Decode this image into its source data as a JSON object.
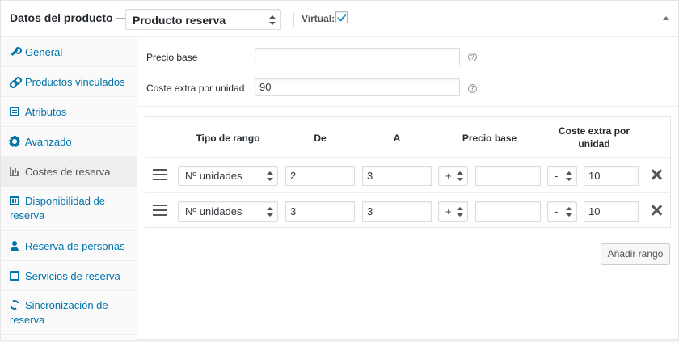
{
  "header": {
    "title": "Datos del producto —",
    "product_type": "Producto reserva",
    "virtual_label": "Virtual:",
    "virtual_checked": true
  },
  "sidebar": {
    "items": [
      {
        "label": "General",
        "icon": "wrench-icon",
        "active": false
      },
      {
        "label": "Productos vinculados",
        "icon": "link-icon",
        "active": false
      },
      {
        "label": "Atributos",
        "icon": "list-icon",
        "active": false
      },
      {
        "label": "Avanzado",
        "icon": "gear-icon",
        "active": false
      },
      {
        "label": "Costes de reserva",
        "icon": "bar-chart-icon",
        "active": true
      },
      {
        "label": "Disponibilidad de reserva",
        "icon": "calendar-icon",
        "active": false
      },
      {
        "label": "Reserva de personas",
        "icon": "person-icon",
        "active": false
      },
      {
        "label": "Servicios de reserva",
        "icon": "window-icon",
        "active": false
      },
      {
        "label": "Sincronización de reserva",
        "icon": "sync-icon",
        "active": false
      }
    ]
  },
  "fields": {
    "base_price_label": "Precio base",
    "base_price_value": "",
    "extra_cost_label": "Coste extra por unidad",
    "extra_cost_value": "90",
    "help_glyph": "?"
  },
  "table": {
    "headers": {
      "range_type": "Tipo de rango",
      "from": "De",
      "to": "A",
      "base_price": "Precio base",
      "extra_cost": "Coste extra por unidad"
    },
    "rows": [
      {
        "range_type": "Nº unidades",
        "from": "2",
        "to": "3",
        "base_op": "+",
        "base_price": "",
        "extra_op": "-",
        "extra_cost": "10"
      },
      {
        "range_type": "Nº unidades",
        "from": "3",
        "to": "3",
        "base_op": "+",
        "base_price": "",
        "extra_op": "-",
        "extra_cost": "10"
      }
    ]
  },
  "actions": {
    "add_range_label": "Añadir rango"
  },
  "colors": {
    "link": "#0073aa",
    "checkbox_tick": "#1e8cbe"
  }
}
